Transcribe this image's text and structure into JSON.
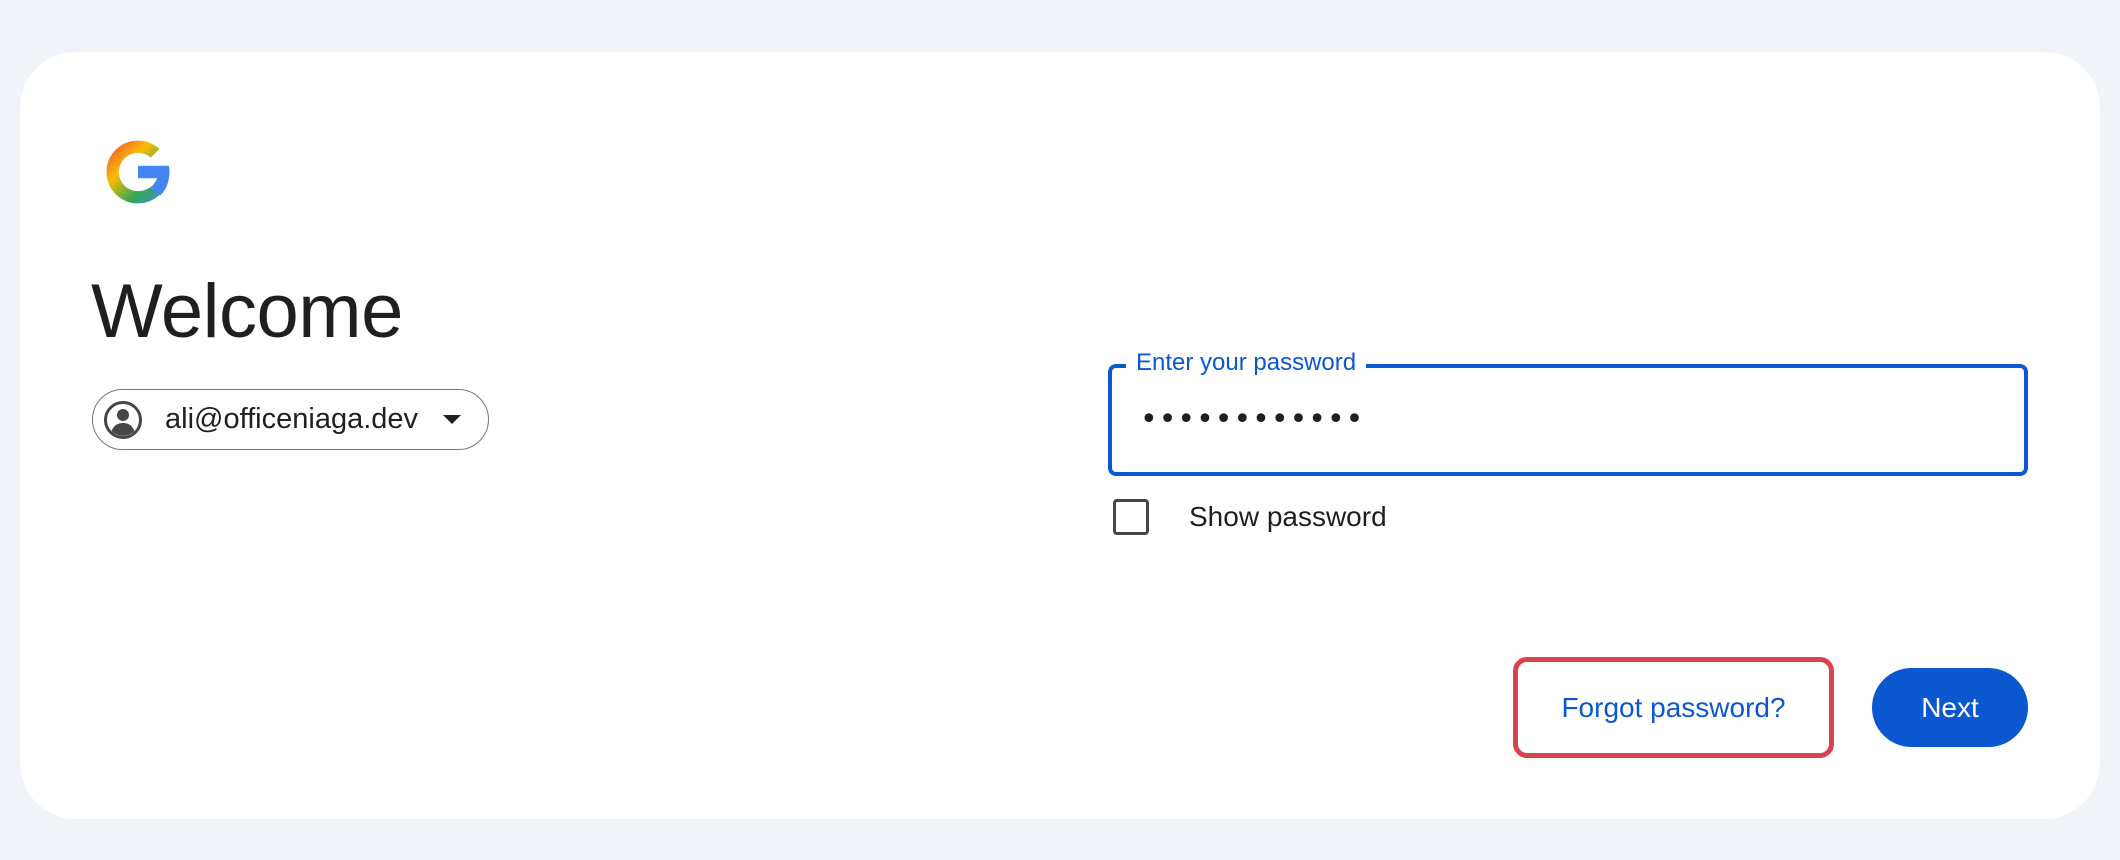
{
  "brand": {
    "logo_icon": "google-g-icon",
    "logo_colors": [
      "#ea4335",
      "#fbbc04",
      "#34a853",
      "#4285f4"
    ]
  },
  "header": {
    "title": "Welcome"
  },
  "account": {
    "avatar_icon": "account-circle-icon",
    "email": "ali@officeniaga.dev",
    "dropdown_icon": "caret-down-icon"
  },
  "password_field": {
    "label": "Enter your password",
    "value": "••••••••••••",
    "accent_color": "#0b57d0"
  },
  "show_password": {
    "label": "Show password",
    "checked": false
  },
  "actions": {
    "forgot_label": "Forgot password?",
    "next_label": "Next",
    "forgot_highlight_color": "#d9434d",
    "next_color": "#0b57d0"
  }
}
